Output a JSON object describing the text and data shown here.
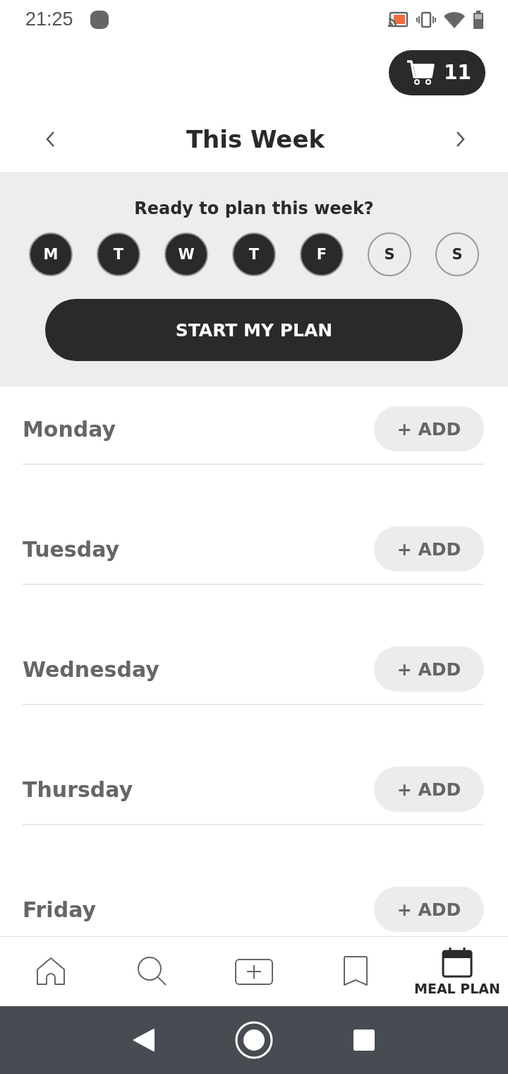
{
  "status_bar": {
    "time": "21:25"
  },
  "cart": {
    "count": "11"
  },
  "week_nav": {
    "title": "This Week"
  },
  "plan_panel": {
    "prompt": "Ready to plan this week?",
    "days": [
      {
        "letter": "M",
        "selected": true
      },
      {
        "letter": "T",
        "selected": true
      },
      {
        "letter": "W",
        "selected": true
      },
      {
        "letter": "T",
        "selected": true
      },
      {
        "letter": "F",
        "selected": true
      },
      {
        "letter": "S",
        "selected": false
      },
      {
        "letter": "S",
        "selected": false
      }
    ],
    "button": "START MY PLAN"
  },
  "days": [
    {
      "name": "Monday",
      "action": "+ ADD"
    },
    {
      "name": "Tuesday",
      "action": "+ ADD"
    },
    {
      "name": "Wednesday",
      "action": "+ ADD"
    },
    {
      "name": "Thursday",
      "action": "+ ADD"
    },
    {
      "name": "Friday",
      "action": "+ ADD"
    }
  ],
  "bottom_nav": [
    {
      "kind": "home",
      "selected": false
    },
    {
      "kind": "search",
      "selected": false
    },
    {
      "kind": "add",
      "selected": false
    },
    {
      "kind": "saved",
      "selected": false
    },
    {
      "kind": "calendar",
      "selected": true,
      "label": "MEAL PLAN"
    }
  ]
}
